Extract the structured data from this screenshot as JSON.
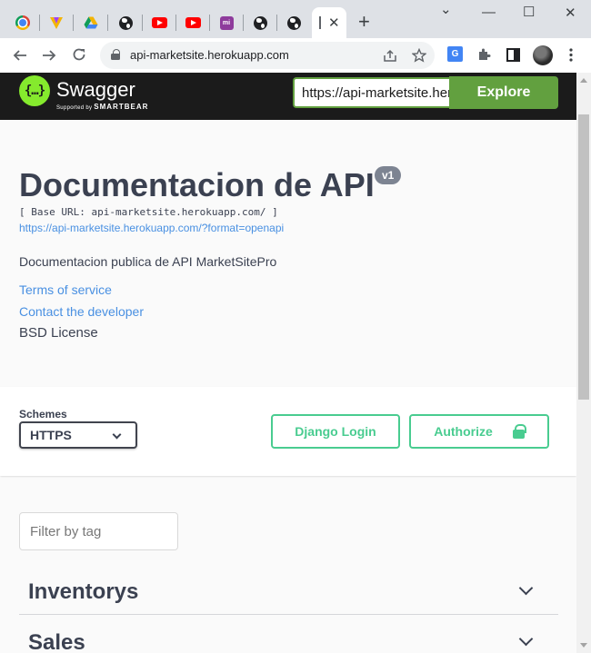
{
  "browser": {
    "tabs": [
      {
        "icon": "chrome-icon"
      },
      {
        "icon": "vivaldi-icon"
      },
      {
        "icon": "google-drive-icon"
      },
      {
        "icon": "globe-icon"
      },
      {
        "icon": "youtube-icon"
      },
      {
        "icon": "youtube-icon"
      },
      {
        "icon": "mi-icon",
        "text": "mi"
      },
      {
        "icon": "globe-icon"
      },
      {
        "icon": "globe-icon"
      }
    ],
    "active_tab_close": "✕",
    "new_tab": "+",
    "window_controls": {
      "dropdown": "⌄",
      "minimize": "—",
      "maximize": "☐",
      "close": "✕"
    },
    "address": "api-marketsite.herokuapp.com",
    "translate_badge": "G"
  },
  "swagger": {
    "logo_text": "{…}",
    "brand": "Swagger",
    "by_prefix": "Supported by",
    "by_company": "SMARTBEAR",
    "explore_url": "https://api-marketsite.herokuapp.com/?format=openapi",
    "explore_label": "Explore",
    "accent_color": "#85ea2d"
  },
  "info": {
    "title": "Documentacion de API",
    "version": "v1",
    "base_url": "[ Base URL: api-marketsite.herokuapp.com/ ]",
    "spec_url": "https://api-marketsite.herokuapp.com/?format=openapi",
    "description": "Documentacion publica de API MarketSitePro",
    "terms": "Terms of service",
    "contact": "Contact the developer",
    "license": "BSD License"
  },
  "schemes": {
    "label": "Schemes",
    "selected": "HTTPS",
    "django_login": "Django Login",
    "authorize": "Authorize",
    "button_color": "#49cc90"
  },
  "operations": {
    "filter_placeholder": "Filter by tag",
    "tags": [
      "Inventorys",
      "Sales"
    ]
  }
}
